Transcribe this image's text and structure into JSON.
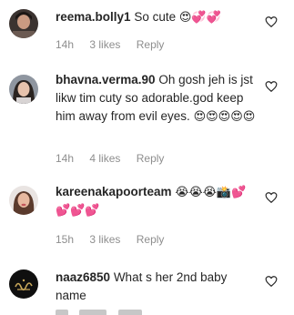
{
  "comments": [
    {
      "username": "reema.bolly1",
      "text": "So cute",
      "emoji": "😍💞💞",
      "time": "14h",
      "likes": "3 likes",
      "reply": "Reply"
    },
    {
      "username": "bhavna.verma.90",
      "text": "Oh gosh jeh is jst likw tim cuty so adorable.god keep him away from evil eyes.",
      "emoji": "😍😍😍😍😍",
      "time": "14h",
      "likes": "4 likes",
      "reply": "Reply"
    },
    {
      "username": "kareenakapoorteam",
      "text": "",
      "emoji": "😭😭😭📸💕💕💕💕",
      "time": "15h",
      "likes": "3 likes",
      "reply": "Reply"
    },
    {
      "username": "naaz6850",
      "text": "What s her 2nd baby name",
      "emoji": "",
      "time": "",
      "likes": "",
      "reply": ""
    }
  ],
  "icons": {
    "like": "heart-outline-icon"
  },
  "colors": {
    "text": "#262626",
    "meta": "#8e8e8e"
  }
}
